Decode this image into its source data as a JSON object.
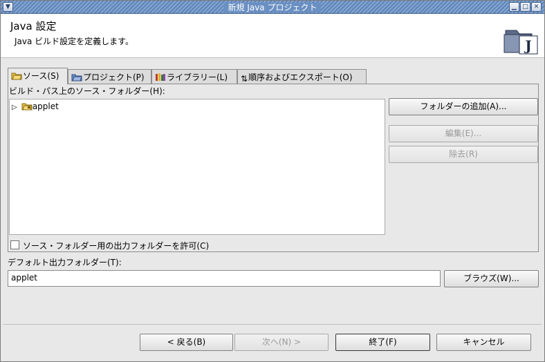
{
  "window": {
    "title": "新規 Java プロジェクト",
    "menu_icon": "chevron-down-icon",
    "controls": [
      "minimize-icon",
      "maximize-icon",
      "close-icon"
    ]
  },
  "header": {
    "title": "Java 設定",
    "description": "Java ビルド設定を定義します。",
    "image_icon": "java-project-wizard-icon"
  },
  "tabs": [
    {
      "label": "ソース(S)",
      "icon": "source-folder-icon",
      "active": true
    },
    {
      "label": "プロジェクト(P)",
      "icon": "project-icon",
      "active": false
    },
    {
      "label": "ライブラリー(L)",
      "icon": "library-icon",
      "active": false
    },
    {
      "label": "順序およびエクスポート(O)",
      "icon": "order-arrows-icon",
      "active": false
    }
  ],
  "source_tab": {
    "tree_label": "ビルド・パス上のソース・フォルダー(H):",
    "tree_items": [
      {
        "label": "applet",
        "expanded": false,
        "icon": "package-folder-icon"
      }
    ],
    "buttons": {
      "add_folder": "フォルダーの追加(A)...",
      "edit": "編集(E)...",
      "remove": "除去(R)"
    },
    "allow_output_folders_label": "ソース・フォルダー用の出力フォルダーを許可(C)",
    "allow_output_folders_checked": false
  },
  "output": {
    "label": "デフォルト出力フォルダー(T):",
    "value": "applet",
    "browse_label": "ブラウズ(W)..."
  },
  "footer": {
    "back": "< 戻る(B)",
    "next": "次へ(N) >",
    "finish": "終了(F)",
    "cancel": "キャンセル"
  },
  "colors": {
    "titlebar": "#6a8fc2",
    "window_bg": "#e8e8e8",
    "folder": "#e8c34a"
  }
}
